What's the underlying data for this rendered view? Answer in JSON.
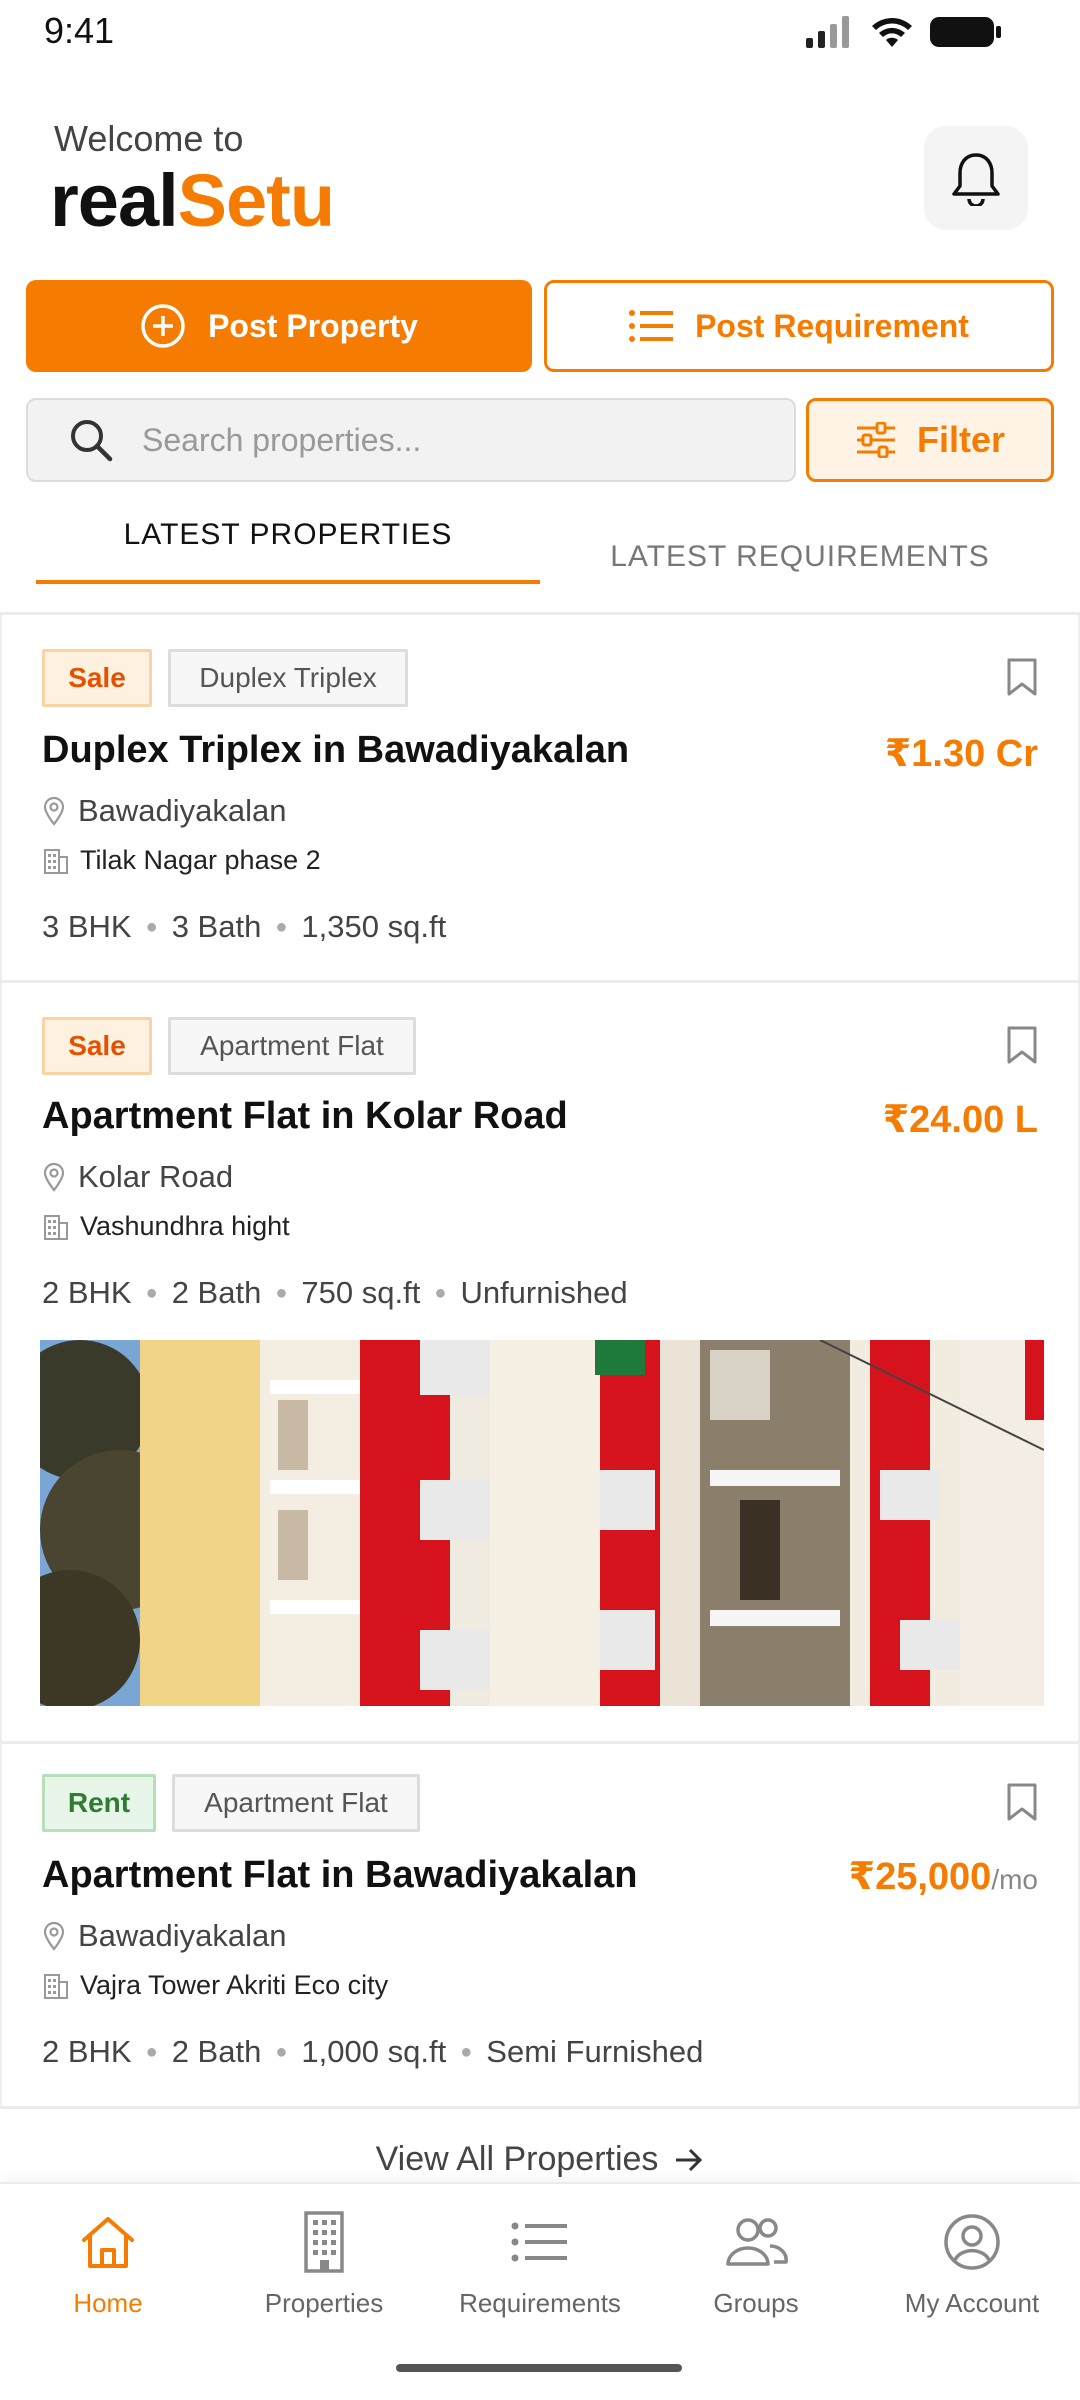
{
  "status_bar": {
    "time": "9:41"
  },
  "header": {
    "welcome": "Welcome to",
    "brand_part1": "real",
    "brand_part2": "Setu",
    "bell_icon": "bell-icon"
  },
  "actions": {
    "post_property": "Post Property",
    "post_requirement": "Post Requirement"
  },
  "search": {
    "placeholder": "Search properties...",
    "filter_label": "Filter"
  },
  "tabs": {
    "latest_properties": "LATEST PROPERTIES",
    "latest_requirements": "LATEST REQUIREMENTS",
    "active": "latest_properties"
  },
  "properties": [
    {
      "listing": "Sale",
      "type": "Duplex Triplex",
      "title": "Duplex Triplex in Bawadiyakalan",
      "price": "₹1.30 Cr",
      "location": "Bawadiyakalan",
      "project": "Tilak Nagar phase 2",
      "specs": [
        "3 BHK",
        "3 Bath",
        "1,350 sq.ft"
      ]
    },
    {
      "listing": "Sale",
      "type": "Apartment Flat",
      "title": "Apartment Flat in Kolar Road",
      "price": "₹24.00 L",
      "location": "Kolar Road",
      "project": "Vashundhra hight",
      "specs": [
        "2 BHK",
        "2 Bath",
        "750 sq.ft",
        "Unfurnished"
      ]
    },
    {
      "listing": "Rent",
      "type": "Apartment Flat",
      "title": "Apartment Flat in Bawadiyakalan",
      "price": "₹25,000",
      "price_suffix": "/mo",
      "location": "Bawadiyakalan",
      "project": "Vajra Tower Akriti Eco city",
      "specs": [
        "2 BHK",
        "2 Bath",
        "1,000 sq.ft",
        "Semi Furnished"
      ]
    }
  ],
  "view_all": "View All Properties",
  "bottom_nav": [
    {
      "label": "Home",
      "icon": "home-icon",
      "active": true
    },
    {
      "label": "Properties",
      "icon": "building-icon",
      "active": false
    },
    {
      "label": "Requirements",
      "icon": "list-icon",
      "active": false
    },
    {
      "label": "Groups",
      "icon": "groups-icon",
      "active": false
    },
    {
      "label": "My Account",
      "icon": "account-icon",
      "active": false
    }
  ],
  "colors": {
    "accent": "#f57c00",
    "sale_badge": "#fff1e0",
    "rent_badge": "#e8f5e9"
  }
}
